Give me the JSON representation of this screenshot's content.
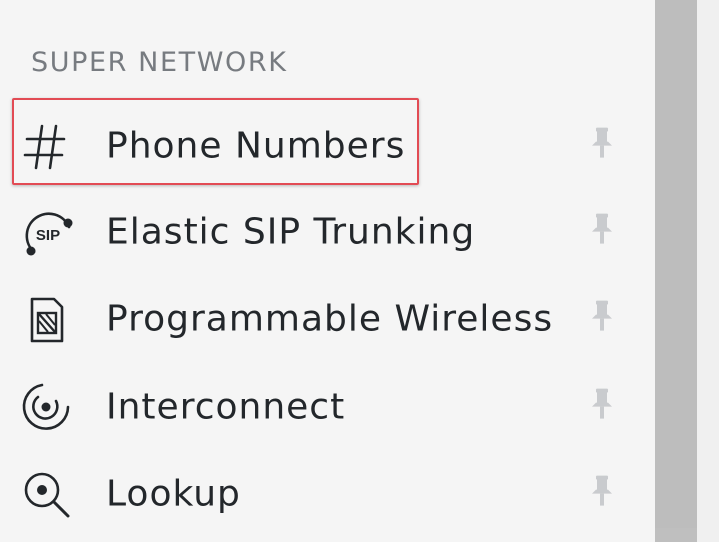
{
  "section": {
    "title": "SUPER NETWORK"
  },
  "items": [
    {
      "label": "Phone Numbers",
      "icon": "hash-icon",
      "selected": true
    },
    {
      "label": "Elastic SIP Trunking",
      "icon": "sip-icon",
      "sip_text": "SIP"
    },
    {
      "label": "Programmable Wireless",
      "icon": "sim-card-icon"
    },
    {
      "label": "Interconnect",
      "icon": "interconnect-icon"
    },
    {
      "label": "Lookup",
      "icon": "lookup-icon"
    }
  ],
  "colors": {
    "highlight_border": "#e24b54",
    "text": "#23272b",
    "section_title": "#777b80",
    "pin": "#c9cbce",
    "scrollbar": "#bfbfbf"
  }
}
